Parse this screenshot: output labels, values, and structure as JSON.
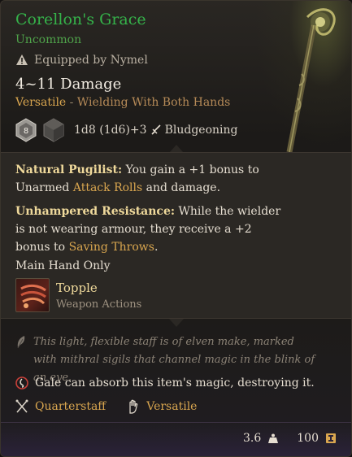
{
  "item": {
    "name": "Corellon's Grace",
    "rarity": "Uncommon",
    "equipped_label": "Equipped by Nymel",
    "damage": "4~11 Damage",
    "versatile": "Versatile",
    "versatile_sep": " - ",
    "wield_note": "Wielding With Both Hands",
    "die_value": "8",
    "dice_formula": "1d8 (1d6)+3",
    "damage_type": "Bludgeoning"
  },
  "properties": [
    {
      "name": "Natural Pugilist:",
      "text_before": " You gain a +1 bonus to Unarmed ",
      "link": "Attack Rolls",
      "text_after": " and damage."
    },
    {
      "name": "Unhampered Resistance:",
      "text_before": " While the wielder is not wearing armour, they receive a +2 bonus to ",
      "link": "Saving Throws",
      "text_after": "."
    }
  ],
  "main_hand": "Main Hand Only",
  "action": {
    "name": "Topple",
    "category": "Weapon Actions"
  },
  "description": "This light, flexible staff is of elven make, marked with mithral sigils that channel magic in the blink of an eye.",
  "absorb_text": "Gale can absorb this item's magic, destroying it.",
  "types": {
    "weapon": "Quarterstaff",
    "property": "Versatile"
  },
  "footer": {
    "weight": "3.6",
    "value": "100"
  },
  "colors": {
    "uncommon_green": "#35b24a",
    "accent_gold": "#d9a64f",
    "property_name": "#efd99b"
  },
  "icons": {
    "equipped": "warning-triangle-icon",
    "damage_type": "sword-icon",
    "description": "feather-icon",
    "absorb": "magic-absorb-icon",
    "weapon_type": "quarterstaff-icon",
    "property": "hand-icon",
    "weight": "weight-icon",
    "value": "gold-coin-icon"
  }
}
